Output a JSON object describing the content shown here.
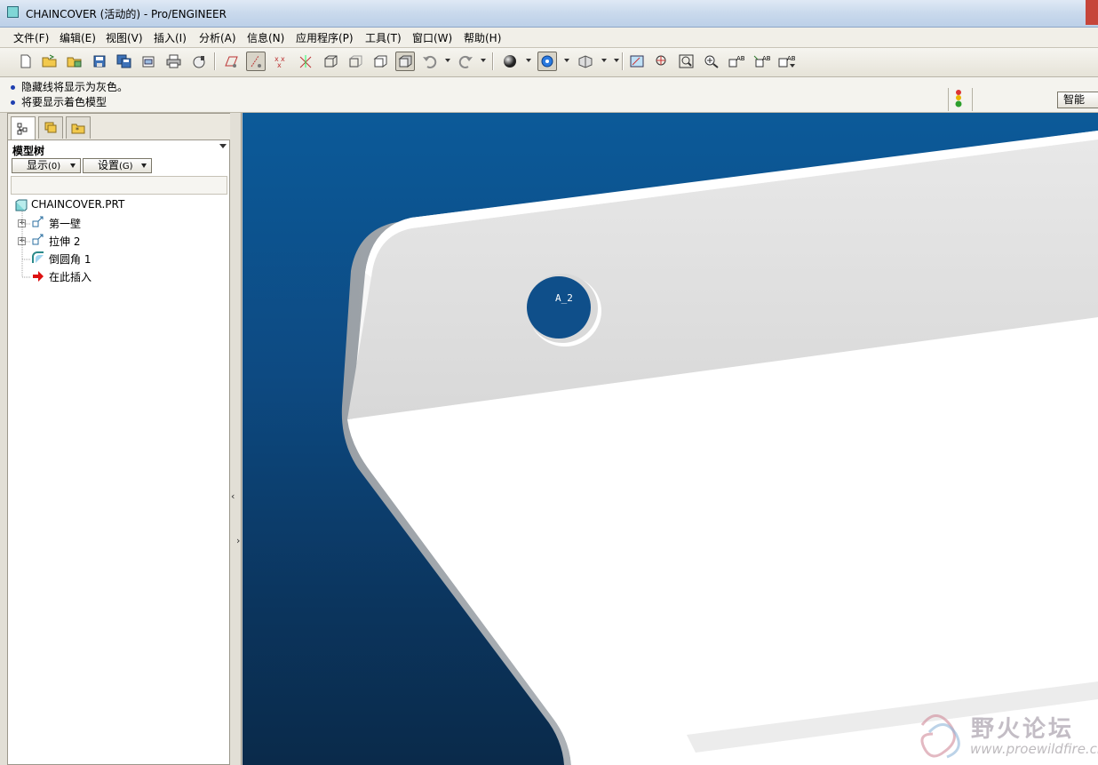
{
  "window": {
    "title": "CHAINCOVER (活动的) - Pro/ENGINEER"
  },
  "menu": [
    "文件(F)",
    "编辑(E)",
    "视图(V)",
    "插入(I)",
    "分析(A)",
    "信息(N)",
    "应用程序(P)",
    "工具(T)",
    "窗口(W)",
    "帮助(H)"
  ],
  "toolbar": {
    "icons": [
      "new-file-icon",
      "open-file-icon",
      "open-folder-icon",
      "save-icon",
      "save-copy-icon",
      "backup-icon",
      "print-icon",
      "send-mail-icon",
      "datum-plane-display-icon",
      "datum-axis-display-icon",
      "datum-point-display-icon",
      "coordinate-system-display-icon",
      "wireframe-icon",
      "hidden-line-icon",
      "no-hidden-icon",
      "shading-icon",
      "undo-icon",
      "redo-icon",
      "sphere-render-icon",
      "spin-center-icon",
      "saved-view-icon",
      "repaint-icon",
      "orient-icon",
      "zoom-fit-icon",
      "zoom-in-icon",
      "view-list-icon",
      "named-view-icon",
      "layer-icon"
    ]
  },
  "messages": [
    "隐藏线将显示为灰色。",
    "将要显示着色模型"
  ],
  "filter": {
    "smart_label": "智能"
  },
  "left_panel": {
    "title": "模型树",
    "display_button": "显示",
    "display_shortcut": "(0)",
    "settings_button": "设置",
    "settings_shortcut": "(G)",
    "tree": [
      {
        "label": "CHAINCOVER.PRT",
        "icon": "part-icon"
      },
      {
        "label": "第一壁",
        "icon": "extrude-icon",
        "expandable": true
      },
      {
        "label": "拉伸 2",
        "icon": "extrude-icon",
        "expandable": true
      },
      {
        "label": "倒圆角 1",
        "icon": "round-icon"
      },
      {
        "label": "在此插入",
        "icon": "insert-here-arrow-icon"
      }
    ]
  },
  "model": {
    "annotation": "A_2"
  },
  "watermark": {
    "title": "野火论坛",
    "url": "www.proewildfire.cn"
  },
  "colors": {
    "viewport_top": "#0c5a99",
    "viewport_bottom": "#0a2a4a",
    "part_face": "#dedede",
    "part_top": "#f7f7f7",
    "message_bullet": "#1f3fb0"
  }
}
